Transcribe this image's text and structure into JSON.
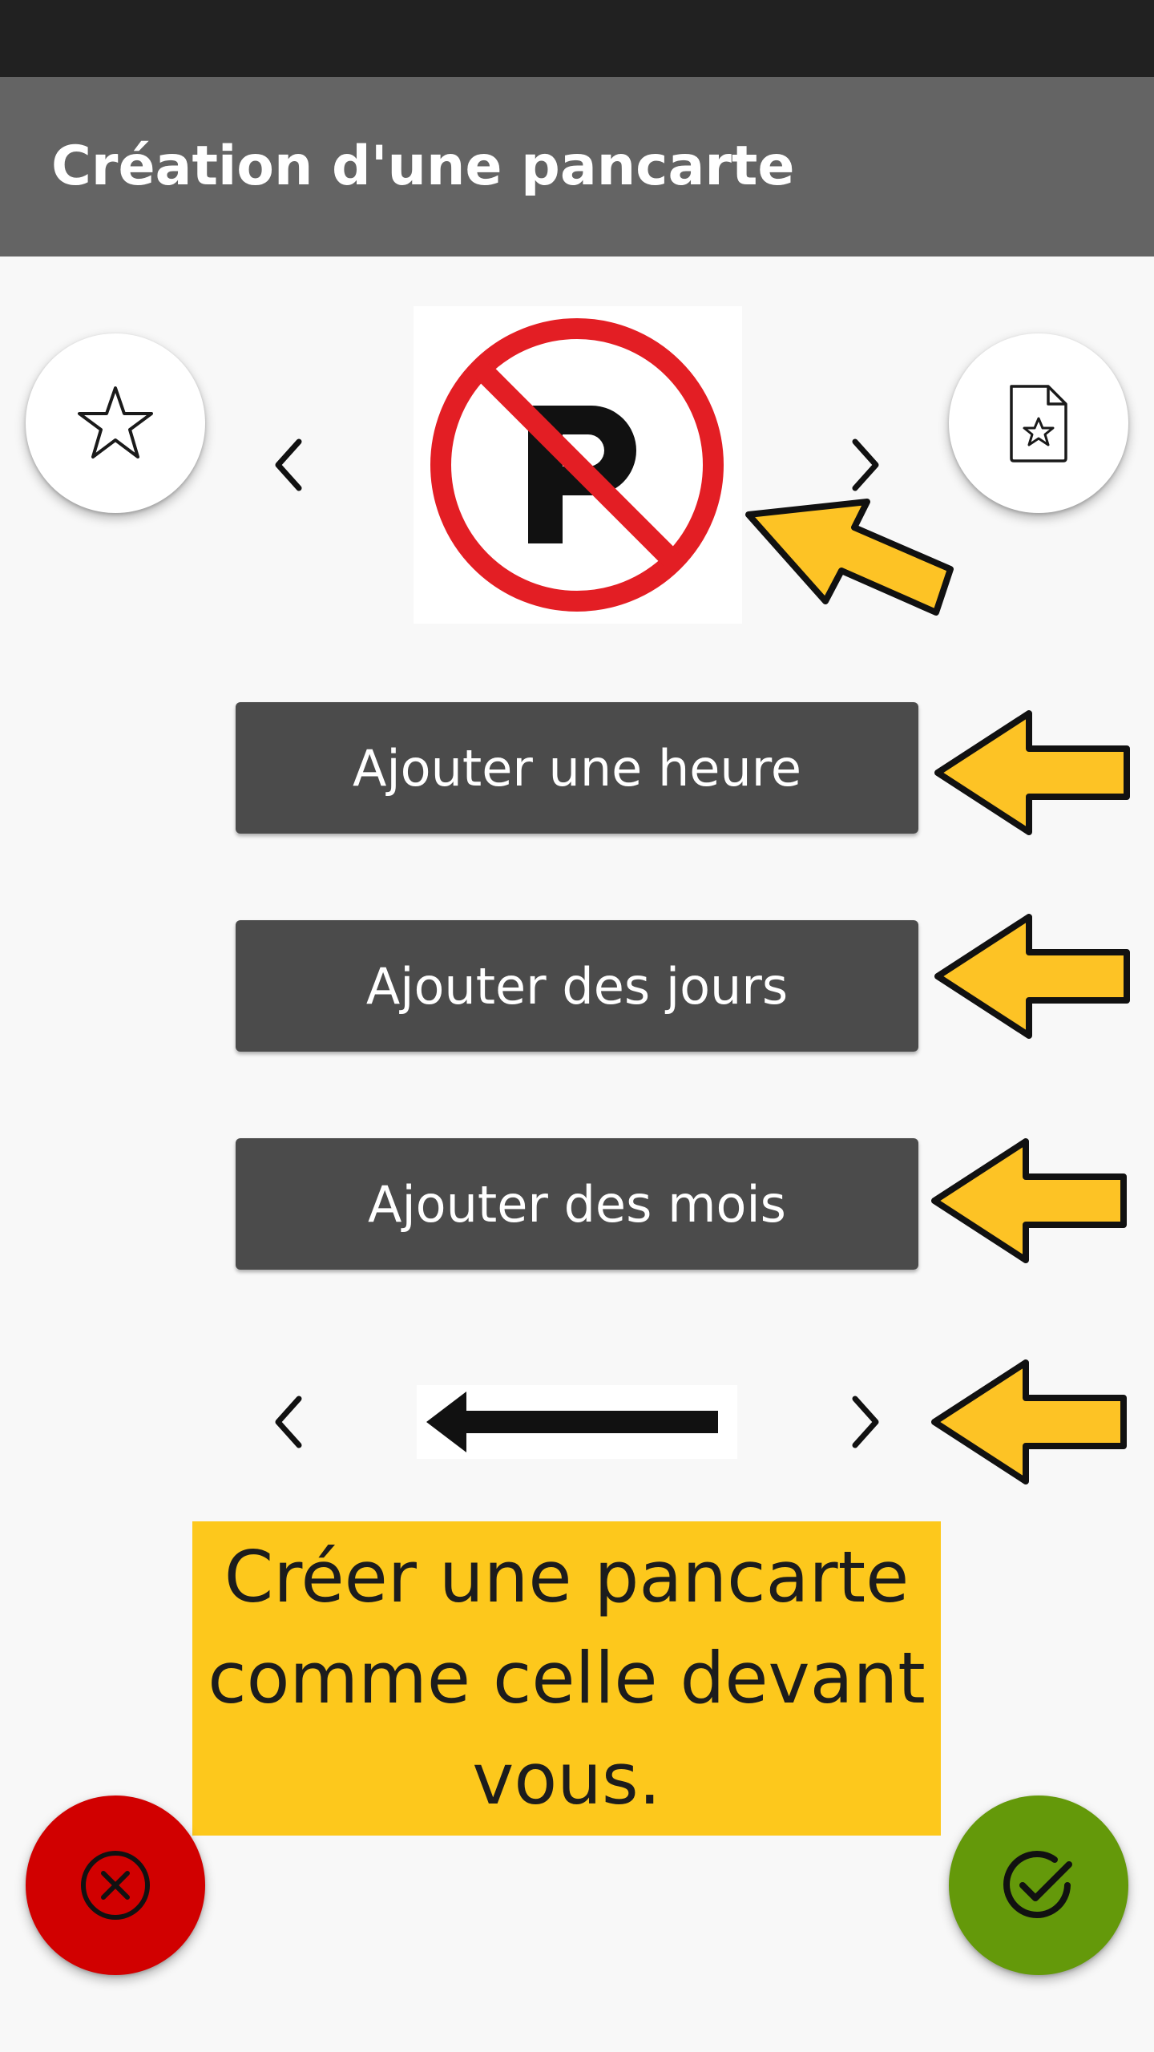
{
  "header": {
    "title": "Création d'une pancarte"
  },
  "icons": {
    "favorite": "star-outline-icon",
    "document": "document-star-icon",
    "sign": "no-parking-sign-icon",
    "direction": "left-arrow-icon",
    "prev": "chevron-left-icon",
    "next": "chevron-right-icon",
    "cancel": "close-circle-icon",
    "confirm": "check-circle-icon",
    "pointer": "yellow-pointer-arrow-icon"
  },
  "buttons": {
    "add_hour": "Ajouter une heure",
    "add_days": "Ajouter des jours",
    "add_months": "Ajouter des mois"
  },
  "instruction": "Créer une pancarte comme celle devant vous.",
  "colors": {
    "status_bar": "#212121",
    "app_bar": "#646464",
    "button": "#4b4b4b",
    "instruction_bg": "#fdc81c",
    "cancel": "#d10000",
    "confirm": "#64990a",
    "sign_red": "#e31e24",
    "pointer_yellow": "#fdc325"
  }
}
